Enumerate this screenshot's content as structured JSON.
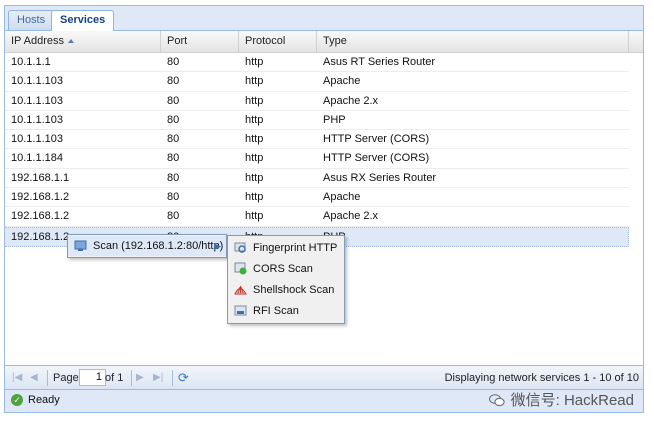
{
  "tabs": [
    {
      "label": "Hosts",
      "active": false
    },
    {
      "label": "Services",
      "active": true
    }
  ],
  "grid": {
    "columns": [
      "IP Address",
      "Port",
      "Protocol",
      "Type"
    ],
    "sorted_column": "IP Address",
    "rows": [
      {
        "ip": "10.1.1.1",
        "port": "80",
        "protocol": "http",
        "type": "Asus RT Series Router"
      },
      {
        "ip": "10.1.1.103",
        "port": "80",
        "protocol": "http",
        "type": "Apache"
      },
      {
        "ip": "10.1.1.103",
        "port": "80",
        "protocol": "http",
        "type": "Apache 2.x"
      },
      {
        "ip": "10.1.1.103",
        "port": "80",
        "protocol": "http",
        "type": "PHP"
      },
      {
        "ip": "10.1.1.103",
        "port": "80",
        "protocol": "http",
        "type": "HTTP Server (CORS)"
      },
      {
        "ip": "10.1.1.184",
        "port": "80",
        "protocol": "http",
        "type": "HTTP Server (CORS)"
      },
      {
        "ip": "192.168.1.1",
        "port": "80",
        "protocol": "http",
        "type": "Asus RX Series Router"
      },
      {
        "ip": "192.168.1.2",
        "port": "80",
        "protocol": "http",
        "type": "Apache"
      },
      {
        "ip": "192.168.1.2",
        "port": "80",
        "protocol": "http",
        "type": "Apache 2.x"
      },
      {
        "ip": "192.168.1.2",
        "port": "80",
        "protocol": "http",
        "type": "PHP",
        "selected": true
      }
    ]
  },
  "context_menu": {
    "scan_label": "Scan (192.168.1.2:80/http)",
    "submenu": [
      {
        "label": "Fingerprint HTTP",
        "icon": "fingerprint-icon"
      },
      {
        "label": "CORS Scan",
        "icon": "cors-scan-icon"
      },
      {
        "label": "Shellshock Scan",
        "icon": "shellshock-icon"
      },
      {
        "label": "RFI Scan",
        "icon": "rfi-scan-icon"
      }
    ]
  },
  "pager": {
    "page_label": "Page",
    "page_value": "1",
    "of_label": "of 1",
    "display_text": "Displaying network services 1 - 10 of 10"
  },
  "status": {
    "text": "Ready"
  },
  "watermark": {
    "text": "微信号: HackRead"
  }
}
